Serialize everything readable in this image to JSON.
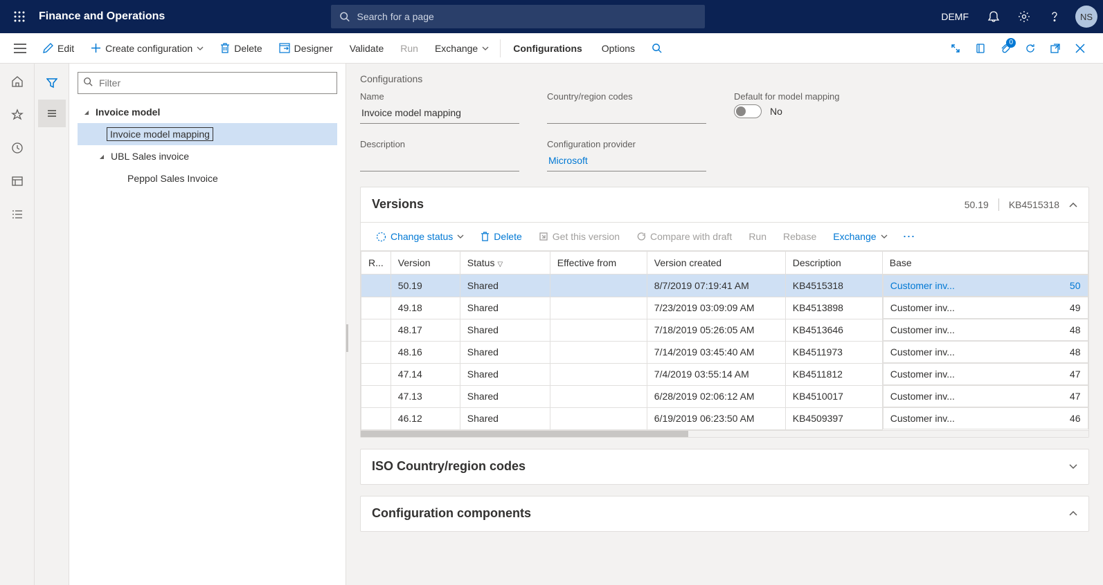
{
  "header": {
    "app_title": "Finance and Operations",
    "search_placeholder": "Search for a page",
    "company": "DEMF",
    "avatar": "NS"
  },
  "action_bar": {
    "edit": "Edit",
    "create_config": "Create configuration",
    "delete": "Delete",
    "designer": "Designer",
    "validate": "Validate",
    "run": "Run",
    "exchange": "Exchange",
    "configurations": "Configurations",
    "options": "Options",
    "badge": "0"
  },
  "tree": {
    "filter_placeholder": "Filter",
    "items": [
      {
        "label": "Invoice model",
        "level": 0,
        "bold": true,
        "expanded": true
      },
      {
        "label": "Invoice model mapping",
        "level": 1,
        "selected": true
      },
      {
        "label": "UBL Sales invoice",
        "level": 1,
        "expanded": true
      },
      {
        "label": "Peppol Sales Invoice",
        "level": 2
      }
    ]
  },
  "detail": {
    "section_title": "Configurations",
    "name_label": "Name",
    "name_value": "Invoice model mapping",
    "region_label": "Country/region codes",
    "region_value": "",
    "default_label": "Default for model mapping",
    "default_value": "No",
    "description_label": "Description",
    "description_value": "",
    "provider_label": "Configuration provider",
    "provider_value": "Microsoft"
  },
  "versions": {
    "title": "Versions",
    "summary_version": "50.19",
    "summary_kb": "KB4515318",
    "toolbar": {
      "change_status": "Change status",
      "delete": "Delete",
      "get_version": "Get this version",
      "compare": "Compare with draft",
      "run": "Run",
      "rebase": "Rebase",
      "exchange": "Exchange"
    },
    "columns": {
      "r": "R...",
      "version": "Version",
      "status": "Status",
      "effective": "Effective from",
      "created": "Version created",
      "description": "Description",
      "base": "Base"
    },
    "rows": [
      {
        "version": "50.19",
        "status": "Shared",
        "effective": "",
        "created": "8/7/2019 07:19:41 AM",
        "description": "KB4515318",
        "base": "Customer inv...",
        "basenum": "50",
        "selected": true
      },
      {
        "version": "49.18",
        "status": "Shared",
        "effective": "",
        "created": "7/23/2019 03:09:09 AM",
        "description": "KB4513898",
        "base": "Customer inv...",
        "basenum": "49"
      },
      {
        "version": "48.17",
        "status": "Shared",
        "effective": "",
        "created": "7/18/2019 05:26:05 AM",
        "description": "KB4513646",
        "base": "Customer inv...",
        "basenum": "48"
      },
      {
        "version": "48.16",
        "status": "Shared",
        "effective": "",
        "created": "7/14/2019 03:45:40 AM",
        "description": "KB4511973",
        "base": "Customer inv...",
        "basenum": "48"
      },
      {
        "version": "47.14",
        "status": "Shared",
        "effective": "",
        "created": "7/4/2019 03:55:14 AM",
        "description": "KB4511812",
        "base": "Customer inv...",
        "basenum": "47"
      },
      {
        "version": "47.13",
        "status": "Shared",
        "effective": "",
        "created": "6/28/2019 02:06:12 AM",
        "description": "KB4510017",
        "base": "Customer inv...",
        "basenum": "47"
      },
      {
        "version": "46.12",
        "status": "Shared",
        "effective": "",
        "created": "6/19/2019 06:23:50 AM",
        "description": "KB4509397",
        "base": "Customer inv...",
        "basenum": "46"
      }
    ]
  },
  "iso_section": {
    "title": "ISO Country/region codes"
  },
  "components_section": {
    "title": "Configuration components"
  }
}
